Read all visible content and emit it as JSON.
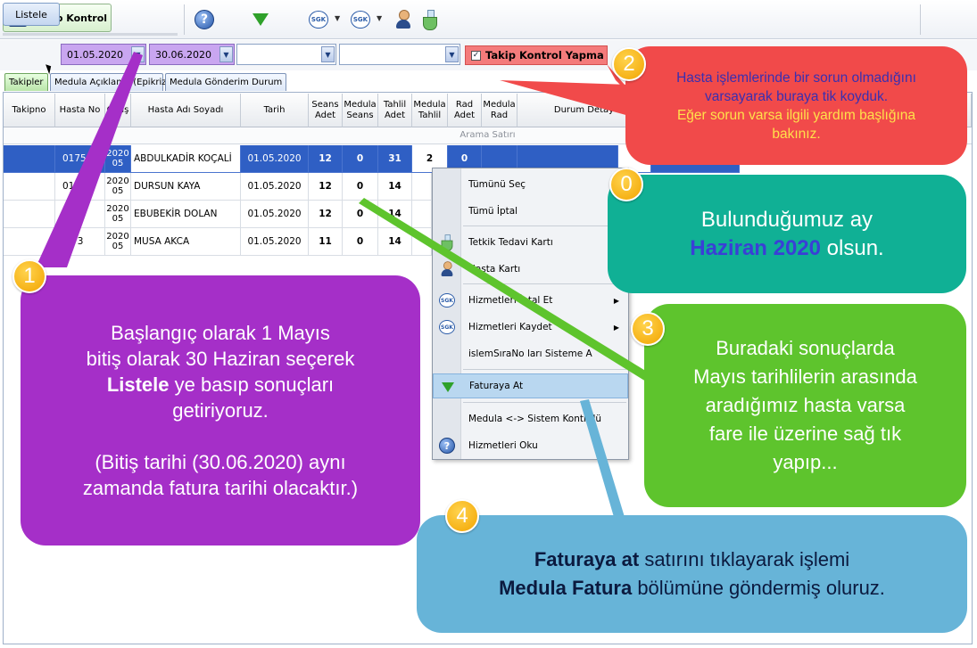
{
  "toolbar": {
    "tab_label": "Takip Kontrol",
    "sgk1": "SGK",
    "sgk2": "SGK"
  },
  "filter": {
    "listele_label": "Listele",
    "start_date": "01.05.2020",
    "end_date": "30.06.2020",
    "checkbox_label": "Takip Kontrol Yapma",
    "checkbox_checked": "✓"
  },
  "tabs": [
    "Takipler",
    "Medula Açıklama (Epikriz)",
    "Medula Gönderim Durum"
  ],
  "grid": {
    "headers": [
      "Takipno",
      "Hasta No",
      "Geliş",
      "Hasta Adı Soyadı",
      "Tarih",
      "Seans Adet",
      "Medula Seans",
      "Tahlil Adet",
      "Medula Tahlil",
      "Rad Adet",
      "Medula Rad",
      "Durum Detay"
    ],
    "search_row": "Arama Satırı",
    "rows": [
      {
        "takipno": "",
        "hasta_no": "017506",
        "year": "2020",
        "month": "05",
        "name": "ABDULKADİR KOÇALİ",
        "date": "01.05.2020",
        "seans": "12",
        "medula_seans": "0",
        "tahlil": "31",
        "medula_tahlil": "2",
        "rad": "0"
      },
      {
        "takipno": "",
        "hasta_no": "01750",
        "year": "2020",
        "month": "05",
        "name": "DURSUN KAYA",
        "date": "01.05.2020",
        "seans": "12",
        "medula_seans": "0",
        "tahlil": "14",
        "medula_tahlil": "",
        "rad": ""
      },
      {
        "takipno": "",
        "hasta_no": "017",
        "year": "2020",
        "month": "05",
        "name": "EBUBEKİR DOLAN",
        "date": "01.05.2020",
        "seans": "12",
        "medula_seans": "0",
        "tahlil": "14",
        "medula_tahlil": "",
        "rad": ""
      },
      {
        "takipno": "",
        "hasta_no": "01 3",
        "year": "2020",
        "month": "05",
        "name": "MUSA AKCA",
        "date": "01.05.2020",
        "seans": "11",
        "medula_seans": "0",
        "tahlil": "14",
        "medula_tahlil": "",
        "rad": ""
      }
    ]
  },
  "context_menu": {
    "items": [
      "Tümünü Seç",
      "Tümü İptal",
      "Tetkik Tedavi Kartı",
      "Hasta Kartı",
      "Hizmetleri İptal Et",
      "Hizmetleri Kaydet",
      "islemSıraNo ları Sisteme A",
      "Faturaya At",
      "Medula <-> Sistem Kontrolü",
      "Hizmetleri Oku"
    ]
  },
  "callouts": {
    "c0": {
      "num": "0",
      "line1": "Bulunduğumuz ay",
      "highlight": "Haziran 2020",
      "rest": " olsun."
    },
    "c1": {
      "num": "1",
      "line1": "Başlangıç olarak 1 Mayıs",
      "line2": "bitiş olarak 30 Haziran  seçerek",
      "bold": "Listele",
      "line3_rest": " ye basıp sonuçları",
      "line4": "getiriyoruz.",
      "line5": "(Bitiş tarihi (30.06.2020) aynı",
      "line6": "zamanda fatura tarihi olacaktır.)"
    },
    "c2": {
      "num": "2",
      "line1": "Hasta işlemlerinde bir sorun olmadığını",
      "line2": "varsayarak buraya tik koyduk.",
      "line3": "Eğer sorun varsa ilgili yardım başlığına",
      "line4": "bakınız."
    },
    "c3": {
      "num": "3",
      "line1": "Buradaki sonuçlarda",
      "line2": "Mayıs tarihlilerin arasında",
      "line3": "aradığımız hasta varsa",
      "line4": "fare ile üzerine sağ tık",
      "line5": "yapıp..."
    },
    "c4": {
      "num": "4",
      "bold1": "Faturaya at",
      "rest1": " satırını tıklayarak işlemi",
      "bold2": "Medula Fatura",
      "rest2": " bölümüne göndermiş oluruz."
    }
  },
  "colors": {
    "callout0": "#10b095",
    "callout1": "#a52fc8",
    "callout2": "#f14a4a",
    "callout3": "#5ec42d",
    "callout4": "#67b4d8",
    "highlight": "#3a3fd6",
    "warning_text": "#ffe14a",
    "date_field": "#c9a6f0"
  }
}
